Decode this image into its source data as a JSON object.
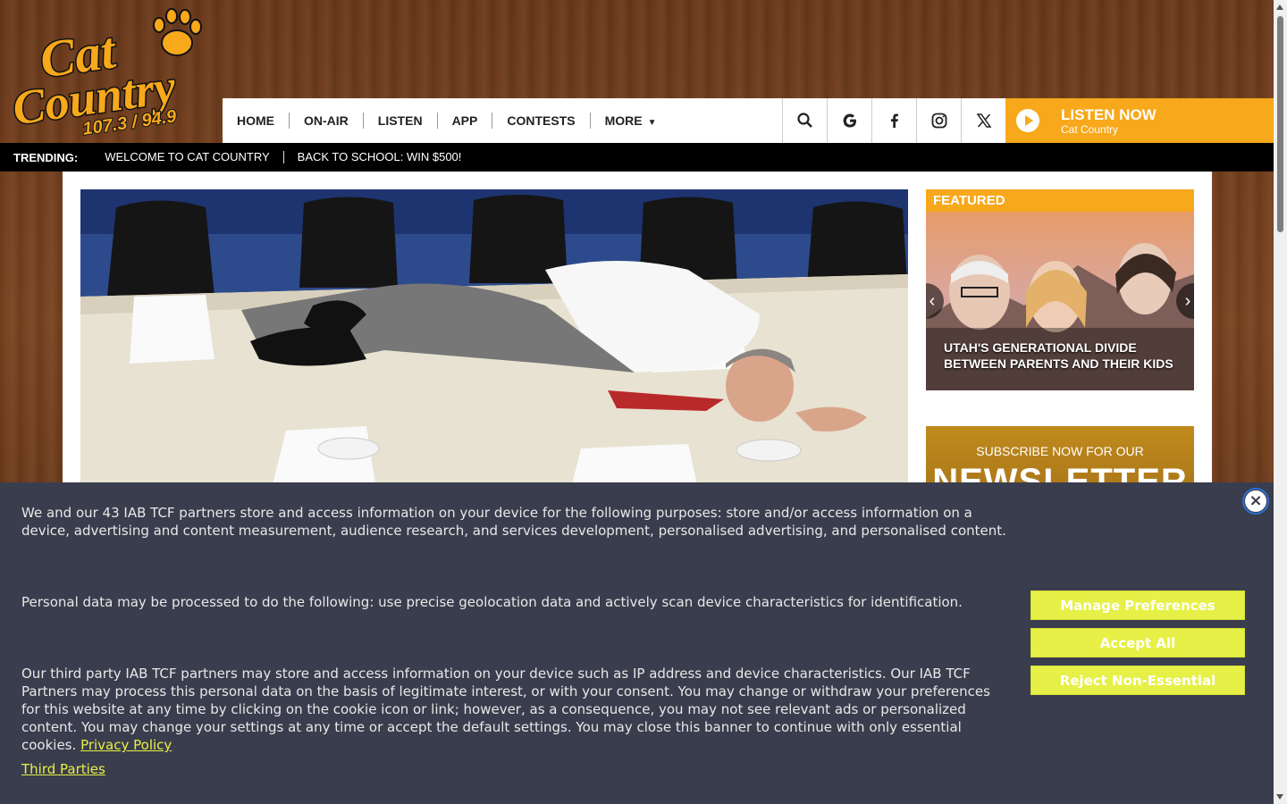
{
  "logo": {
    "line1": "Cat",
    "line2": "Country",
    "line3": "107.3 / 94.9",
    "alt": "cat-country-logo"
  },
  "nav": {
    "links": [
      {
        "label": "HOME"
      },
      {
        "label": "ON-AIR"
      },
      {
        "label": "LISTEN"
      },
      {
        "label": "APP"
      },
      {
        "label": "CONTESTS"
      },
      {
        "label": "MORE"
      }
    ],
    "icons": [
      "search-icon",
      "google-icon",
      "facebook-icon",
      "instagram-icon",
      "x-icon"
    ]
  },
  "listen": {
    "title": "LISTEN NOW",
    "station": "Cat Country"
  },
  "trending": {
    "label": "TRENDING:",
    "items": [
      "WELCOME TO CAT COUNTRY",
      "BACK TO SCHOOL: WIN $500!"
    ]
  },
  "featured": {
    "heading": "FEATURED",
    "caption": "UTAH'S GENERATIONAL DIVIDE BETWEEN PARENTS AND THEIR KIDS"
  },
  "newsletter": {
    "subtitle": "SUBSCRIBE NOW FOR OUR",
    "title": "NEWSLETTER"
  },
  "cookie": {
    "p1": "We and our 43 IAB TCF partners store and access information on your device for the following purposes: store and/or access information on a device, advertising and content measurement, audience research, and services development, personalised advertising, and personalised content.",
    "p2": "Personal data may be processed to do the following: use precise geolocation data and actively scan device characteristics for identification.",
    "p3": "Our third party IAB TCF partners may store and access information on your device such as IP address and device characteristics. Our IAB TCF Partners may process this personal data on the basis of legitimate interest, or with your consent. You may change or withdraw your preferences for this website at any time by clicking on the cookie icon or link; however, as a consequence, you may not see relevant ads or personalized content. You may change your settings at any time or accept the default settings. You may close this banner to continue with only essential cookies.",
    "privacy_link": "Privacy Policy",
    "third_parties": "Third Parties",
    "manage": "Manage Preferences",
    "accept": "Accept All",
    "reject": "Reject Non-Essential",
    "close": "×"
  },
  "colors": {
    "accent": "#f7a81b",
    "cookie_bg": "#3a3d4d",
    "cookie_btn": "#e6f046"
  }
}
